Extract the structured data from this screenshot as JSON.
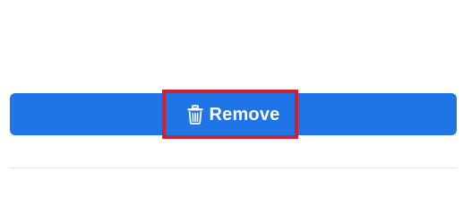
{
  "remove_button": {
    "label": "Remove",
    "icon": "trash-icon",
    "background_color": "#1f74e6",
    "text_color": "#ffffff"
  },
  "highlight": {
    "color": "#d2202f"
  }
}
